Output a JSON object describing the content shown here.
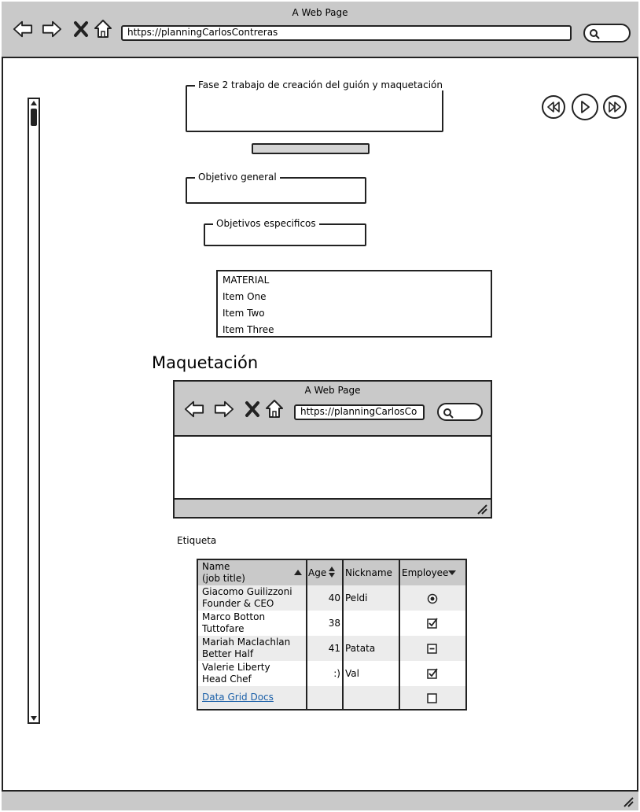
{
  "browser": {
    "title": "A Web Page",
    "url": "https://planningCarlosContreras"
  },
  "content": {
    "fase_title": "Fase 2 trabajo de creación del guión y maquetación",
    "objetivo_general": "Objetivo general",
    "objetivos_especificos": "Objetivos especificos",
    "material_list": {
      "header": "MATERIAL",
      "items": [
        "Item One",
        "Item Two",
        "Item Three"
      ]
    },
    "heading": "Maquetación",
    "etiqueta": "Etiqueta"
  },
  "mini_browser": {
    "title": "A Web Page",
    "url": "https://planningCarlosCo"
  },
  "grid": {
    "headers": {
      "name_line1": "Name",
      "name_line2": "(job title)",
      "age": "Age",
      "nickname": "Nickname",
      "employee": "Employee"
    },
    "rows": [
      {
        "name": "Giacomo Guilizzoni",
        "title": "Founder & CEO",
        "age": "40",
        "nickname": "Peldi",
        "employee": "radio-selected"
      },
      {
        "name": "Marco Botton",
        "title": "Tuttofare",
        "age": "38",
        "nickname": "",
        "employee": "checked"
      },
      {
        "name": "Mariah Maclachlan",
        "title": "Better Half",
        "age": "41",
        "nickname": "Patata",
        "employee": "indeterminate"
      },
      {
        "name": "Valerie Liberty",
        "title": "Head Chef",
        "age": ":)",
        "nickname": "Val",
        "employee": "checked"
      }
    ],
    "footer_link": "Data Grid Docs",
    "footer_employee": "unchecked"
  },
  "icons": {
    "back": "back-arrow-icon",
    "forward": "forward-arrow-icon",
    "stop": "close-icon",
    "home": "home-icon",
    "search": "search-icon",
    "rewind": "rewind-icon",
    "play": "play-icon",
    "fast_forward": "fast-forward-icon",
    "resize": "resize-grip-icon"
  },
  "colors": {
    "chrome": "#c9c9c9",
    "link": "#1a5fa8",
    "row_alt": "#ececec"
  }
}
